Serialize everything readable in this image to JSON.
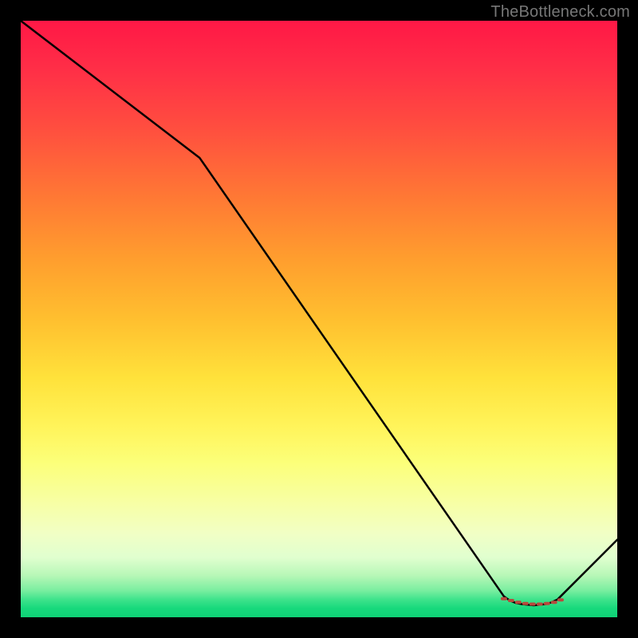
{
  "watermark": "TheBottleneck.com",
  "chart_data": {
    "type": "line",
    "title": "",
    "xlabel": "",
    "ylabel": "",
    "xlim": [
      0,
      100
    ],
    "ylim": [
      0,
      100
    ],
    "grid": false,
    "legend": false,
    "series": [
      {
        "name": "curve",
        "x": [
          0,
          30,
          81,
          82,
          83,
          84,
          85,
          86,
          87,
          88,
          89,
          90,
          100
        ],
        "y": [
          100,
          77,
          3.5,
          2.8,
          2.4,
          2.2,
          2.1,
          2.0,
          2.1,
          2.2,
          2.5,
          3.0,
          13
        ]
      }
    ],
    "markers": {
      "name": "trough-dots",
      "x": [
        81,
        82.2,
        83.4,
        84.6,
        85.8,
        87.0,
        88.2,
        89.4,
        90.5
      ],
      "y": [
        3.1,
        2.8,
        2.5,
        2.3,
        2.2,
        2.2,
        2.3,
        2.5,
        2.9
      ],
      "color": "#b84a3d",
      "size": 4
    }
  }
}
